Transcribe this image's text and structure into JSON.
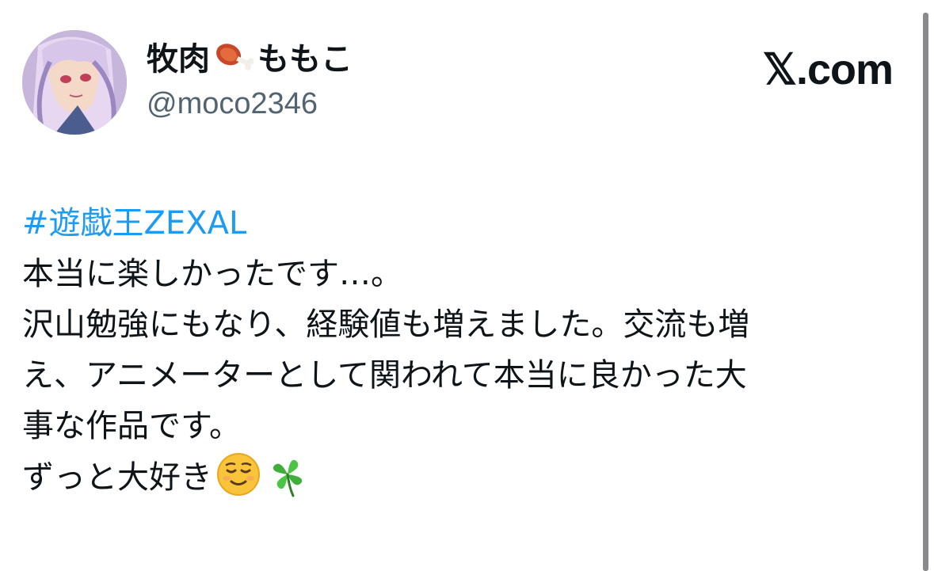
{
  "user": {
    "display_name_part1": "牧肉",
    "display_name_icon": "meat-on-bone-icon",
    "display_name_part2": "ももこ",
    "handle": "@moco2346",
    "avatar": "avatar-illustration"
  },
  "brand": {
    "label": "𝕏.com"
  },
  "tweet": {
    "hashtag": "#遊戯王ZEXAL",
    "lines": [
      "本当に楽しかったです…。",
      "沢山勉強にもなり、経験値も増えました。交流も増",
      "え、アニメーターとして関われて本当に良かった大",
      "事な作品です。",
      "ずっと大好き"
    ],
    "trailing_emojis": [
      "relieved-face-icon",
      "four-leaf-clover-icon"
    ]
  },
  "colors": {
    "text": "#0f1419",
    "secondary": "#536471",
    "link": "#1d9bf0"
  }
}
